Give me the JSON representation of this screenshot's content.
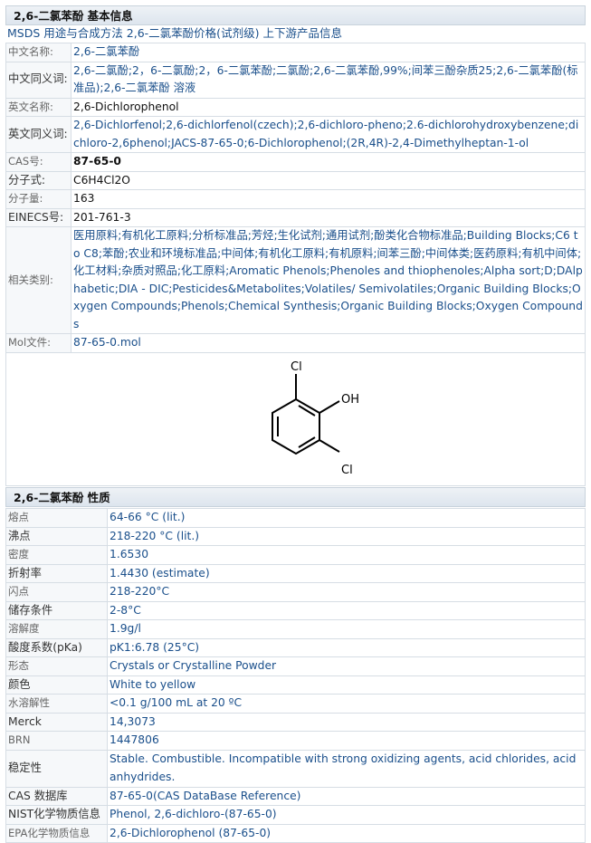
{
  "basic": {
    "title": "2,6-二氯苯酚 基本信息",
    "links": [
      "MSDS",
      "用途与合成方法",
      "2,6-二氯苯酚价格(试剂级)",
      "上下游产品信息"
    ],
    "rows": [
      {
        "label": "中文名称:",
        "value": "2,6-二氯苯酚"
      },
      {
        "label": "中文同义词:",
        "value": "2,6-二氯酚;2，6-二氯酚;2，6-二氯苯酚;二氯酚;2,6-二氯苯酚,99%;间苯三酚杂质25;2,6-二氯苯酚(标准品);2,6-二氯苯酚 溶液"
      },
      {
        "label": "英文名称:",
        "value": "2,6-Dichlorophenol"
      },
      {
        "label": "英文同义词:",
        "value": "2,6-Dichlorfenol;2,6-dichlorfenol(czech);2,6-dichloro-pheno;2.6-dichlorohydroxybenzene;dichloro-2,6phenol;JACS-87-65-0;6-Dichlorophenol;(2R,4R)-2,4-Dimethylheptan-1-ol"
      },
      {
        "label": "CAS号:",
        "value": "87-65-0"
      },
      {
        "label": "分子式:",
        "value": "C6H4Cl2O"
      },
      {
        "label": "分子量:",
        "value": "163"
      },
      {
        "label": "EINECS号:",
        "value": "201-761-3"
      },
      {
        "label": "相关类别:",
        "value": "医用原料;有机化工原料;分析标准品;芳烃;生化试剂;通用试剂;酚类化合物标准品;Building Blocks;C6 to C8;苯酚;农业和环境标准品;中间体;有机化工原料;有机原料;间苯三酚;中间体类;医药原料;有机中间体;化工材料;杂质对照品;化工原料;Aromatic Phenols;Phenoles and thiophenoles;Alpha sort;D;DAlphabetic;DIA - DIC;Pesticides&Metabolites;Volatiles/ Semivolatiles;Organic Building Blocks;Oxygen Compounds;Phenols;Chemical Synthesis;Organic Building Blocks;Oxygen Compounds"
      },
      {
        "label": "Mol文件:",
        "value": "87-65-0.mol"
      }
    ],
    "structure": {
      "cl_top": "Cl",
      "oh": "OH",
      "cl_bottom": "Cl"
    }
  },
  "props": {
    "title": "2,6-二氯苯酚 性质",
    "rows": [
      {
        "label": "熔点",
        "value": "64-66 °C (lit.)"
      },
      {
        "label": "沸点",
        "value": "218-220 °C (lit.)"
      },
      {
        "label": "密度",
        "value": "1.6530"
      },
      {
        "label": "折射率",
        "value": "1.4430 (estimate)"
      },
      {
        "label": "闪点",
        "value": "218-220°C"
      },
      {
        "label": "储存条件",
        "value": "2-8°C"
      },
      {
        "label": "溶解度",
        "value": "1.9g/l"
      },
      {
        "label": "酸度系数(pKa)",
        "value": "pK1:6.78 (25°C)"
      },
      {
        "label": "形态",
        "value": "Crystals or Crystalline Powder"
      },
      {
        "label": "颜色",
        "value": "White to yellow"
      },
      {
        "label": "水溶解性",
        "value": "<0.1 g/100 mL at 20 ºC"
      },
      {
        "label": "Merck",
        "value": "14,3073"
      },
      {
        "label": "BRN",
        "value": "1447806"
      },
      {
        "label": "稳定性",
        "value": "Stable. Combustible. Incompatible with strong oxidizing agents, acid chlorides, acid anhydrides."
      },
      {
        "label": "CAS 数据库",
        "value": "87-65-0(CAS DataBase Reference)"
      },
      {
        "label": "NIST化学物质信息",
        "value": "Phenol, 2,6-dichloro-(87-65-0)"
      },
      {
        "label": "EPA化学物质信息",
        "value": "2,6-Dichlorophenol (87-65-0)"
      }
    ]
  }
}
